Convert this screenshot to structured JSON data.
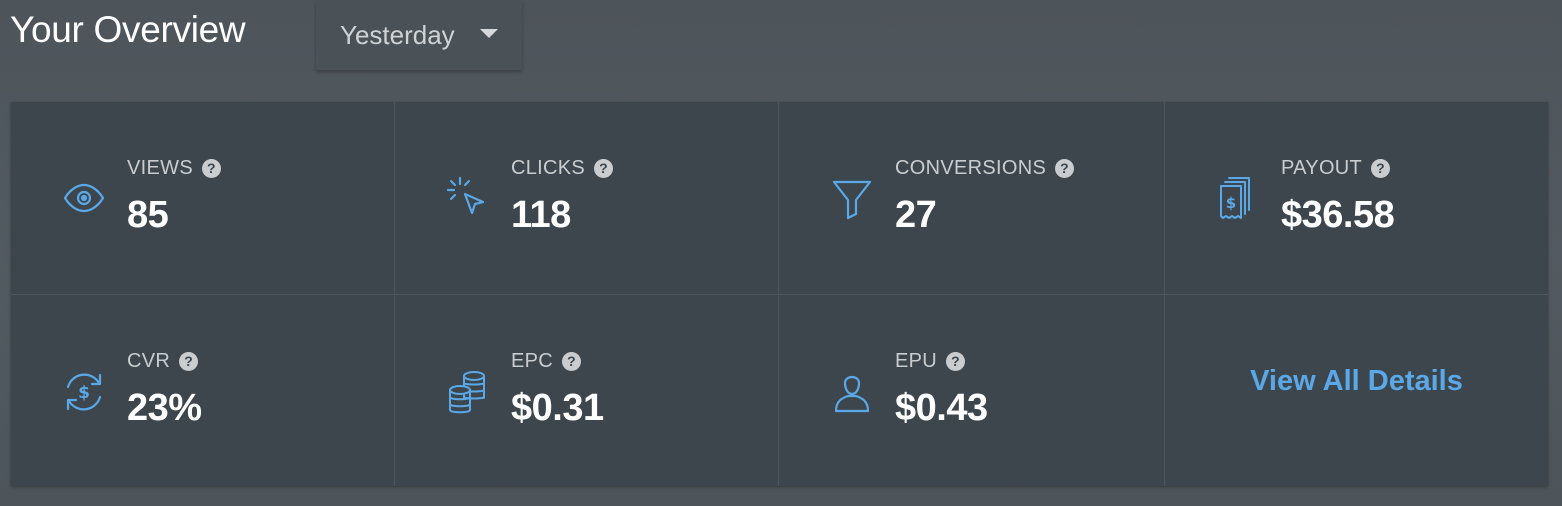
{
  "header": {
    "title": "Your Overview",
    "period": "Yesterday"
  },
  "stats": [
    {
      "label": "VIEWS",
      "value": "85",
      "icon": "eye-icon"
    },
    {
      "label": "CLICKS",
      "value": "118",
      "icon": "cursor-click-icon"
    },
    {
      "label": "CONVERSIONS",
      "value": "27",
      "icon": "funnel-icon"
    },
    {
      "label": "PAYOUT",
      "value": "$36.58",
      "icon": "receipts-dollar-icon"
    },
    {
      "label": "CVR",
      "value": "23%",
      "icon": "dollar-cycle-icon"
    },
    {
      "label": "EPC",
      "value": "$0.31",
      "icon": "coin-stack-icon"
    },
    {
      "label": "EPU",
      "value": "$0.43",
      "icon": "user-icon"
    }
  ],
  "help_glyph": "?",
  "view_all_label": "View All Details",
  "colors": {
    "accent": "#5aa8e8",
    "panel": "#3d464c",
    "background": "#51585f",
    "text": "#ffffff",
    "muted": "#c9cdd0"
  }
}
